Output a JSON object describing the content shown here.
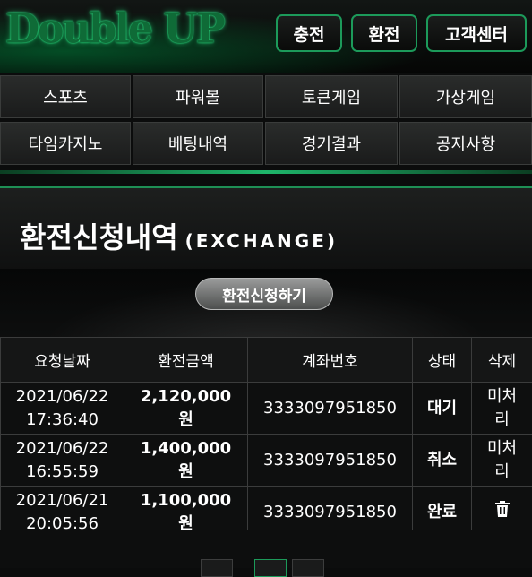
{
  "header": {
    "logo": "Double UP",
    "buttons": [
      "충전",
      "환전",
      "고객센터"
    ]
  },
  "nav": {
    "items": [
      "스포츠",
      "파워볼",
      "토큰게임",
      "가상게임",
      "타임카지노",
      "베팅내역",
      "경기결과",
      "공지사항"
    ]
  },
  "page": {
    "title": "환전신청내역",
    "subtitle": "(EXCHANGE)",
    "request_button": "환전신청하기"
  },
  "table": {
    "headers": [
      "요청날짜",
      "환전금액",
      "계좌번호",
      "상태",
      "삭제"
    ],
    "rows": [
      {
        "date": "2021/06/22",
        "time": "17:36:40",
        "amount": "2,120,000",
        "unit": "원",
        "account": "3333097951850",
        "status": "대기",
        "delete": "미처리",
        "delete_icon": ""
      },
      {
        "date": "2021/06/22",
        "time": "16:55:59",
        "amount": "1,400,000",
        "unit": "원",
        "account": "3333097951850",
        "status": "취소",
        "delete": "미처리",
        "delete_icon": ""
      },
      {
        "date": "2021/06/21",
        "time": "20:05:56",
        "amount": "1,100,000",
        "unit": "원",
        "account": "3333097951850",
        "status": "완료",
        "delete": "",
        "delete_icon": "trash-icon"
      }
    ]
  },
  "colors": {
    "accent_green": "#1c9a5a",
    "amount_blue": "#1e6bff"
  }
}
